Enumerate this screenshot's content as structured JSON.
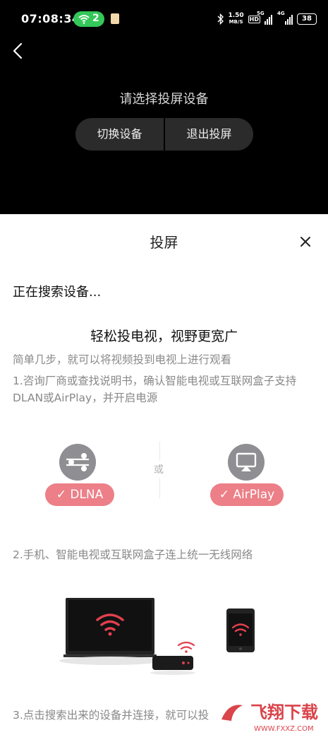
{
  "status_bar": {
    "time": "07:08:34",
    "wifi_hotspot_count": "2",
    "net_speed_value": "1.50",
    "net_speed_unit": "MB/S",
    "hd_badge": "HD",
    "sim1_tag": "5G",
    "sim2_tag": "4G",
    "battery": "38"
  },
  "cast_screen": {
    "prompt": "请选择投屏设备",
    "switch_device": "切换设备",
    "exit_cast": "退出投屏"
  },
  "sheet": {
    "title": "投屏",
    "searching": "正在搜索设备...",
    "headline": "轻松投电视，视野更宽广",
    "subtitle": "简单几步，就可以将视频投到电视上进行观看",
    "step1": "1.咨询厂商或查找说明书，确认智能电视或互联网盒子支持DLAN或AirPlay，并开启电源",
    "dlna_label": "✓ DLNA",
    "or_label": "或",
    "airplay_label": "✓ AirPlay",
    "step2": "2.手机、智能电视或互联网盒子连上统一无线网络",
    "step3": "3.点击搜索出来的设备并连接，就可以投"
  },
  "watermark": {
    "text": "飞翔下载",
    "url": "WWW.FXXZ.COM"
  },
  "colors": {
    "accent_red": "#ec7f87",
    "wifi_red": "#e2404f",
    "hotspot_green": "#34c759",
    "watermark_red": "#d4232b"
  },
  "icons": [
    "back-arrow-icon",
    "close-icon",
    "dlna-icon",
    "airplay-icon",
    "wifi-icon",
    "battery-icon"
  ]
}
